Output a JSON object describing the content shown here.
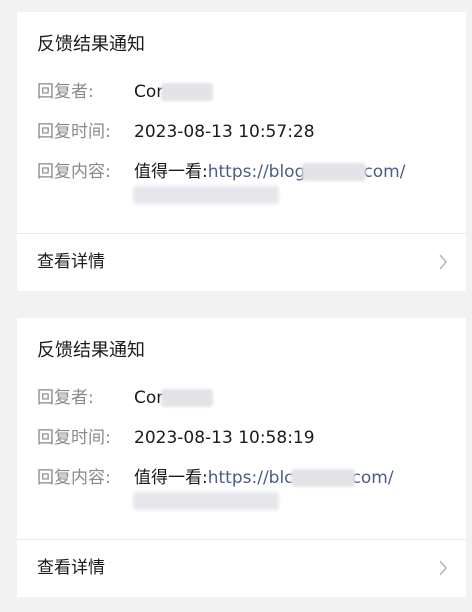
{
  "notifications": [
    {
      "title": "反馈结果通知",
      "replier_label": "回复者:",
      "replier_value": "Cor",
      "time_label": "回复时间:",
      "time_value": "2023-08-13 10:57:28",
      "content_label": "回复内容:",
      "content_prefix": "值得一看:",
      "link_start": "https://blog",
      "link_end": "com/",
      "detail_label": "查看详情"
    },
    {
      "title": "反馈结果通知",
      "replier_label": "回复者:",
      "replier_value": "Cor",
      "time_label": "回复时间:",
      "time_value": "2023-08-13 10:58:19",
      "content_label": "回复内容:",
      "content_prefix": "值得一看:",
      "link_start": "https://blc",
      "link_end": "com/",
      "detail_label": "查看详情"
    }
  ],
  "icons": {
    "detail_arrow": "chevron-right-icon"
  },
  "colors": {
    "background": "#f2f2f2",
    "card": "#ffffff",
    "label": "#8a8a8a",
    "text": "#1a1a1a",
    "link": "#4a5d85",
    "chevron": "#b5b5b5"
  }
}
